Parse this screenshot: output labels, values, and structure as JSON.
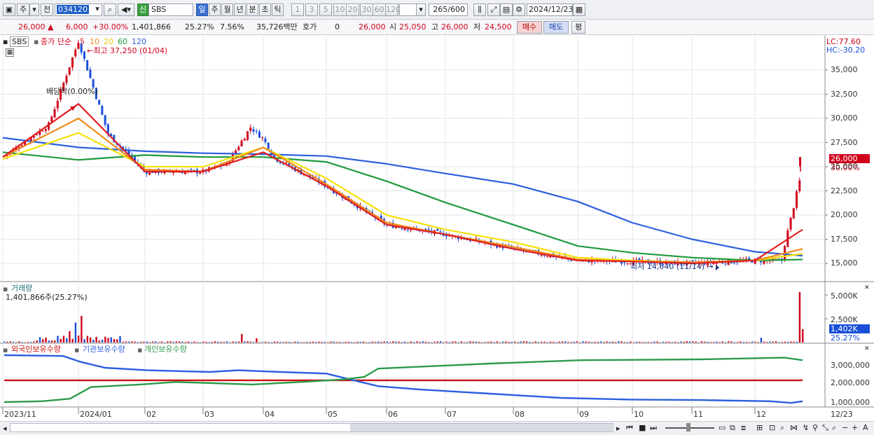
{
  "toolbar": {
    "mode_label": "주",
    "prev_label": "전",
    "code": "034120",
    "market_badge": "신",
    "stock_name": "SBS",
    "period_buttons": [
      "일",
      "주",
      "월",
      "년",
      "분",
      "초",
      "틱"
    ],
    "active_period": "일",
    "interval_buttons": [
      "1",
      "3",
      "5",
      "10",
      "20",
      "30",
      "60",
      "120"
    ],
    "count_value": "265",
    "count_max": "/600",
    "date_value": "2024/12/23"
  },
  "quote": {
    "price": "26,000",
    "change": "6,000",
    "change_pct": "+30.00%",
    "volume": "1,401,866",
    "turnover_ratio": "25.27%",
    "ratio2": "7.56%",
    "amount": "35,726백만",
    "hoga_label": "호가",
    "hoga_value": "0",
    "hoga_price": "26,000",
    "open_label": "시",
    "open": "25,050",
    "high_label": "고",
    "high": "26,000",
    "low_label": "저",
    "low": "24,500",
    "buy_label": "매수",
    "sell_label": "매도",
    "eval_label": "평"
  },
  "price_panel": {
    "title": "SBS",
    "ma_label": "종가 단순",
    "ma_periods": [
      "5",
      "10",
      "20",
      "60",
      "120"
    ],
    "high_annotation": "최고 37,250 (01/04)",
    "low_annotation": "최저 14,640 (11/14)",
    "dividend_annotation": "배당락(0.00%)",
    "lc_label": "LC:77.60",
    "hc_label": "HC:-30.20",
    "price_tag": "26,000",
    "pct_tag": "30.00%",
    "y_ticks": [
      "35,000",
      "32,500",
      "30,000",
      "27,500",
      "25,000",
      "22,500",
      "20,000",
      "17,500",
      "15,000"
    ]
  },
  "volume_panel": {
    "title": "거래량",
    "value_label": "1,401,866주(25.27%)",
    "y_ticks": [
      "5,000K",
      "2,500K"
    ],
    "tag_value": "1,402K",
    "tag_pct": "25.27%"
  },
  "holdings_panel": {
    "legend": [
      "외국인보유수량",
      "기관보유수량",
      "개인보유수량"
    ],
    "y_ticks": [
      "3,000,000",
      "2,000,000",
      "1,000,000"
    ]
  },
  "x_axis": [
    "2023/11",
    "2024/01",
    "02",
    "03",
    "04",
    "05",
    "06",
    "07",
    "08",
    "09",
    "10",
    "11",
    "12",
    "12/23"
  ],
  "colors": {
    "up": "#d0021b",
    "down": "#1a4fd8",
    "ma5": "#e02020",
    "ma10": "#f08a1c",
    "ma20": "#f5e10a",
    "ma60": "#1f9a3a",
    "ma120": "#2c5fe0",
    "foreign": "#cc1010",
    "institution": "#2c5fe0",
    "individual": "#2e9a4a"
  },
  "chart_data": {
    "type": "candlestick",
    "series": [
      {
        "name": "5",
        "x": [
          "2023/11",
          "2024/01",
          "02",
          "03",
          "04",
          "05",
          "06",
          "07",
          "08",
          "09",
          "10",
          "11",
          "12",
          "12/23"
        ],
        "values": [
          26000,
          31500,
          24500,
          24500,
          26500,
          23000,
          19000,
          18000,
          16500,
          15300,
          15200,
          15000,
          15300,
          18500
        ]
      },
      {
        "name": "10",
        "x": [
          "2023/11",
          "2024/01",
          "02",
          "03",
          "04",
          "05",
          "06",
          "07",
          "08",
          "09",
          "10",
          "11",
          "12",
          "12/23"
        ],
        "values": [
          26000,
          30000,
          24700,
          24500,
          27000,
          23200,
          19200,
          18000,
          16700,
          15400,
          15200,
          15100,
          15300,
          16500
        ]
      },
      {
        "name": "20",
        "x": [
          "2023/11",
          "2024/01",
          "02",
          "03",
          "04",
          "05",
          "06",
          "07",
          "08",
          "09",
          "10",
          "11",
          "12",
          "12/23"
        ],
        "values": [
          25800,
          28500,
          25000,
          25000,
          27000,
          23800,
          20000,
          18500,
          17200,
          15600,
          15300,
          15100,
          15300,
          16000
        ]
      },
      {
        "name": "60",
        "x": [
          "2023/11",
          "2024/01",
          "02",
          "03",
          "04",
          "05",
          "06",
          "07",
          "08",
          "09",
          "10",
          "11",
          "12",
          "12/23"
        ],
        "values": [
          26500,
          25700,
          26200,
          26000,
          26000,
          25500,
          23500,
          21300,
          19000,
          16800,
          16100,
          15600,
          15300,
          15400
        ]
      },
      {
        "name": "120",
        "x": [
          "2023/11",
          "2024/01",
          "02",
          "03",
          "04",
          "05",
          "06",
          "07",
          "08",
          "09",
          "10",
          "11",
          "12",
          "12/23"
        ],
        "values": [
          28000,
          27000,
          26600,
          26400,
          26300,
          26100,
          25300,
          24300,
          23200,
          21400,
          19200,
          17500,
          16200,
          15800
        ]
      }
    ],
    "volume_peak": 5300000,
    "ylim": [
      13500,
      37500
    ]
  }
}
